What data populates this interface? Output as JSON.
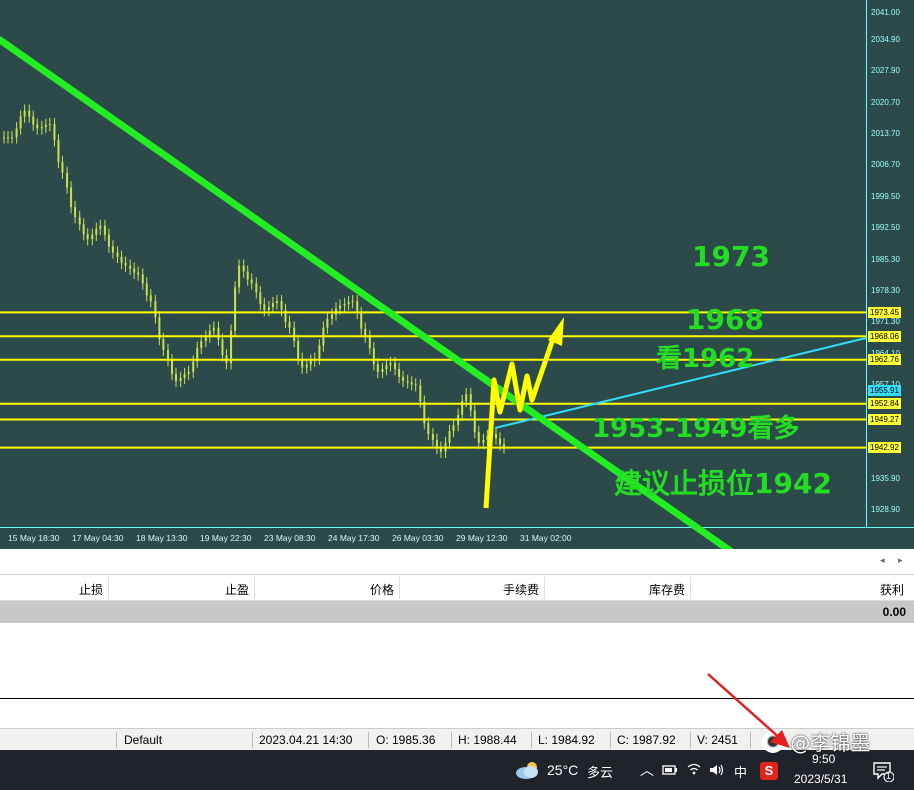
{
  "colors": {
    "background": "#2d4a4a",
    "candle": "#c8e050",
    "level_line": "#ffff00",
    "trend_green": "#22ee22",
    "trend_cyan": "#33ddff",
    "forecast_yellow": "#ffff00",
    "annotation_text": "#22dd22"
  },
  "chart_data": {
    "type": "line",
    "title": "",
    "price_axis": {
      "ticks": [
        "2041.00",
        "2034.90",
        "2027.90",
        "2020.70",
        "2013.70",
        "2006.70",
        "1999.50",
        "1992.50",
        "1985.30",
        "1978.30",
        "1971.30",
        "1964.10",
        "1957.10",
        "1942.92",
        "1935.90",
        "1928.90"
      ],
      "ylim": [
        1925,
        2044
      ]
    },
    "time_axis": {
      "ticks": [
        "15 May 18:30",
        "17 May 04:30",
        "18 May 13:30",
        "19 May 22:30",
        "23 May 08:30",
        "24 May 17:30",
        "26 May 03:30",
        "29 May 12:30",
        "31 May 02:00"
      ]
    },
    "price_series": {
      "name": "",
      "x_index": [
        0,
        1,
        2,
        3,
        4,
        5,
        6,
        7,
        8,
        9,
        10,
        11,
        12,
        13,
        14,
        15,
        16,
        17,
        18,
        19,
        20,
        21,
        22,
        23,
        24,
        25,
        26,
        27,
        28,
        29,
        30,
        31,
        32,
        33,
        34,
        35,
        36,
        37,
        38,
        39
      ],
      "close": [
        2013,
        2019,
        2015,
        2016,
        2005,
        1995,
        1990,
        1993,
        1987,
        1984,
        1982,
        1976,
        1965,
        1958,
        1960,
        1967,
        1970,
        1962,
        1984,
        1980,
        1974,
        1976,
        1970,
        1961,
        1963,
        1972,
        1975,
        1976,
        1968,
        1960,
        1962,
        1958,
        1957,
        1946,
        1942,
        1948,
        1955,
        1944,
        1946,
        1943
      ]
    },
    "price_tags": [
      {
        "value": "1973.45",
        "style": "yellow"
      },
      {
        "value": "1968.06",
        "style": "yellow"
      },
      {
        "value": "1962.76",
        "style": "yellow"
      },
      {
        "value": "1955.91",
        "style": "cyan"
      },
      {
        "value": "1952.84",
        "style": "yellow"
      },
      {
        "value": "1949.27",
        "style": "yellow"
      },
      {
        "value": "1942.92",
        "style": "yellow"
      }
    ],
    "horizontal_levels": [
      1973.45,
      1968.06,
      1962.76,
      1952.84,
      1949.27,
      1942.92
    ],
    "annotations": [
      "1973",
      "1968",
      "看1962",
      "1953-1949看多",
      "建议止损位1942"
    ]
  },
  "orders_table": {
    "headers": [
      "止损",
      "止盈",
      "价格",
      "手续费",
      "库存费",
      "获利"
    ],
    "total_profit": "0.00"
  },
  "status_bar": {
    "profile": "Default",
    "datetime": "2023.04.21 14:30",
    "open": "O: 1985.36",
    "high": "H: 1988.44",
    "low": "L: 1984.92",
    "close": "C: 1987.92",
    "volume": "V: 2451"
  },
  "taskbar": {
    "temperature": "25°C",
    "weather": "多云",
    "ime": "中",
    "time": "9:50",
    "date": "2023/5/31",
    "notification_count": "1",
    "watermark": "@李锦墨"
  }
}
